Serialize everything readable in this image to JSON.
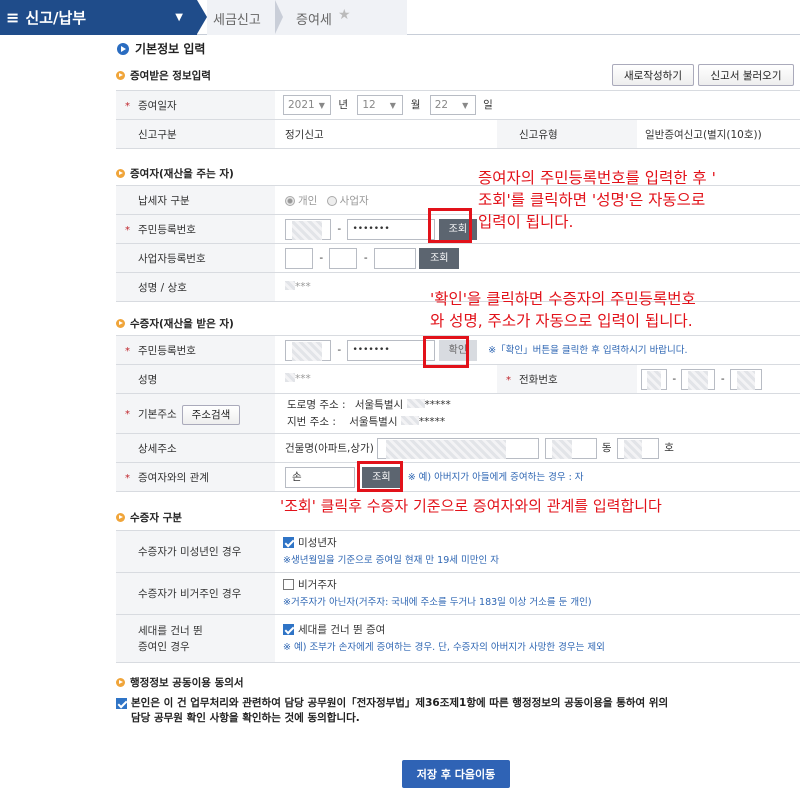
{
  "topbar": {
    "menu_label": "신고/납부",
    "tab1": "세금신고",
    "tab2": "증여세"
  },
  "page_title": "기본정보 입력",
  "sections": {
    "donation_info": "증여받은 정보입력",
    "donor": "증여자(재산을 주는 자)",
    "donee": "수증자(재산을 받은 자)",
    "donee_type": "수증자 구분",
    "admin_info": "행정정보 공동이용 동의서"
  },
  "buttons": {
    "new_write": "새로작성하기",
    "load_report": "신고서 불러오기",
    "lookup": "조회",
    "confirm": "확인",
    "address_search": "주소검색",
    "save_next": "저장 후 다음이동"
  },
  "donation": {
    "date_label": "증여일자",
    "year": "2021",
    "year_unit": "년",
    "month": "12",
    "month_unit": "월",
    "day": "22",
    "day_unit": "일",
    "report_type_label": "신고구분",
    "report_type_value": "정기신고",
    "report_kind_label": "신고유형",
    "report_kind_value": "일반증여신고(별지(10호))"
  },
  "donor": {
    "taxpayer_type_label": "납세자 구분",
    "opt_individual": "개인",
    "opt_business": "사업자",
    "rrn_label": "주민등록번호",
    "rrn_mask": "•••••••",
    "bizno_label": "사업자등록번호",
    "name_label": "성명 / 상호",
    "name_value": "*** "
  },
  "donee": {
    "rrn_label": "주민등록번호",
    "rrn_mask": "•••••••",
    "rrn_note": "※「확인」버튼을 클릭한 후 입력하시기 바랍니다.",
    "name_label": "성명",
    "name_value": "***",
    "phone_label": "전화번호",
    "addr_label": "기본주소",
    "road_addr_label": "도로명 주소 :",
    "road_addr_value": "서울특별시 ",
    "road_addr_mask": "*****",
    "lot_addr_label": "지번 주소 :",
    "lot_addr_value": "서울특별시 ",
    "lot_addr_mask": "*****",
    "detail_label": "상세주소",
    "building_label": "건물명(아파트,상가)",
    "dong_unit": "동",
    "ho_unit": "호",
    "relation_label": "증여자와의 관계",
    "relation_value": "손",
    "relation_note": "※ 예) 아버지가 아들에게 증여하는 경우 : 자"
  },
  "donee_type": {
    "minor_label": "수증자가 미성년인 경우",
    "minor_check": "미성년자",
    "minor_note": "※생년월일을 기준으로 증여일 현재 만 19세 미만인 자",
    "nonres_label": "수증자가 비거주인 경우",
    "nonres_check": "비거주자",
    "nonres_note": "※거주자가 아닌자(거주자: 국내에 주소를 두거나 183일 이상 거소를 둔 개인)",
    "skip_label_line1": "세대를 건너 뛴",
    "skip_label_line2": "증여인 경우",
    "skip_check": "세대를 건너 뛴 증여",
    "skip_note": "※ 예) 조부가 손자에게 증여하는 경우. 단, 수증자의 아버지가 사망한 경우는 제외"
  },
  "agreement": {
    "line1": "본인은 이 건 업무처리와 관련하여 담당 공무원이「전자정부법」제36조제1항에 따른 행정정보의 공동이용을 통하여 위의",
    "line2": "담당 공무원 확인 사항을 확인하는 것에 동의합니다."
  },
  "annotations": {
    "a1_line1": "증여자의 주민등록번호를 입력한 후 '",
    "a1_line2": "조회'를 클릭하면  '성명'은 자동으로",
    "a1_line3": "입력이 됩니다.",
    "a2_line1": "'확인'을 클릭하면 수증자의 주민등록번호",
    "a2_line2": "와 성명, 주소가 자동으로 입력이 됩니다.",
    "a3": "'조회' 클릭후 수증자 기준으로 증여자와의 관계를 입력합니다"
  },
  "colors": {
    "topbar": "#1f4c8a",
    "annotation": "#e2121a",
    "note": "#2e66b3",
    "save_button": "#2f63b5"
  }
}
